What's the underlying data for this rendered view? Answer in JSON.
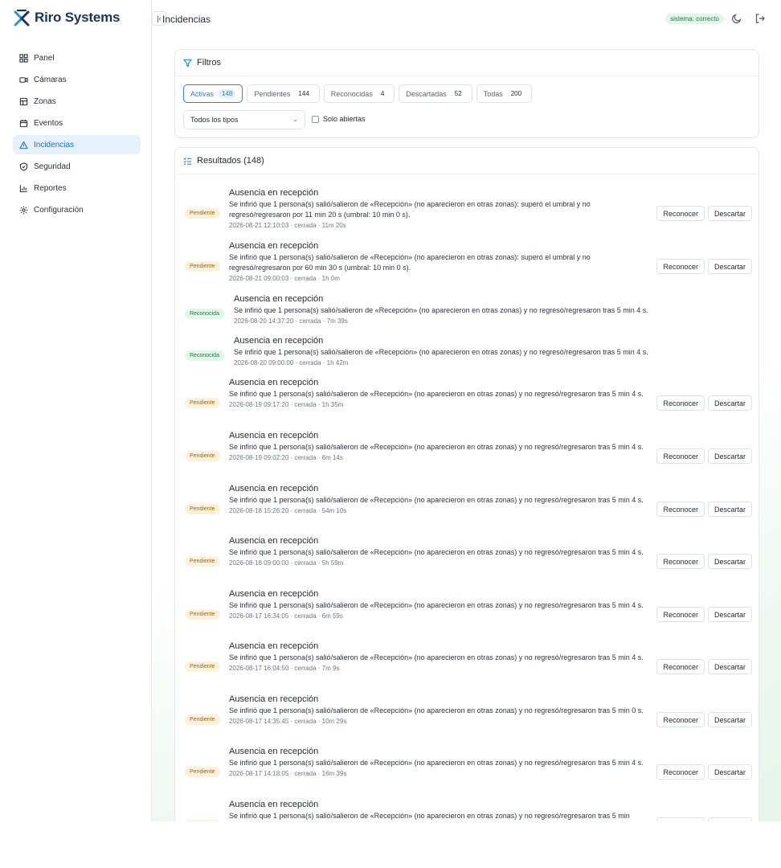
{
  "brand": {
    "name": "Riro Systems"
  },
  "nav": [
    {
      "label": "Panel",
      "icon": "grid-icon",
      "active": false
    },
    {
      "label": "Cámaras",
      "icon": "camera-icon",
      "active": false
    },
    {
      "label": "Zonas",
      "icon": "zone-icon",
      "active": false
    },
    {
      "label": "Eventos",
      "icon": "calendar-icon",
      "active": false
    },
    {
      "label": "Incidencias",
      "icon": "warning-icon",
      "active": true
    },
    {
      "label": "Seguridad",
      "icon": "shield-icon",
      "active": false
    },
    {
      "label": "Reportes",
      "icon": "chart-icon",
      "active": false
    },
    {
      "label": "Configuración",
      "icon": "gear-icon",
      "active": false
    }
  ],
  "header": {
    "collapse_glyph": "|‹",
    "title": "Incidencias",
    "status": "sistema: correcto"
  },
  "filters": {
    "title": "Filtros",
    "tabs": [
      {
        "label": "Activas",
        "count": "148",
        "active": true
      },
      {
        "label": "Pendientes",
        "count": "144",
        "active": false
      },
      {
        "label": "Reconocidas",
        "count": "4",
        "active": false
      },
      {
        "label": "Descartadas",
        "count": "52",
        "active": false
      },
      {
        "label": "Todas",
        "count": "200",
        "active": false
      }
    ],
    "type_select": "Todos los tipos",
    "only_open_label": "Solo abiertas"
  },
  "results": {
    "title": "Resultados (148)",
    "actions": {
      "acknowledge": "Reconocer",
      "discard": "Descartar"
    },
    "items": [
      {
        "status": "Pendiente",
        "title": "Ausencia en recepción",
        "desc": "Se infirió que 1 persona(s) salió/salieron de «Recepción» (no aparecieron en otras zonas): superó el umbral y no regresó/regresaron por 11 min 20 s (umbral: 10 min 0 s).",
        "meta": "2026-08-21 12:10:03 · cerrada · 11m 20s"
      },
      {
        "status": "Pendiente",
        "title": "Ausencia en recepción",
        "desc": "Se infirió que 1 persona(s) salió/salieron de «Recepción» (no aparecieron en otras zonas): superó el umbral y no regresó/regresaron por 60 min 30 s (umbral: 10 min 0 s).",
        "meta": "2026-08-21 09:00:03 · cerrada · 1h 0m"
      },
      {
        "status": "Reconocida",
        "title": "Ausencia en recepción",
        "desc": "Se infirió que 1 persona(s) salió/salieron de «Recepción» (no aparecieron en otras zonas) y no regresó/regresaron tras 5 min 4 s.",
        "meta": "2026-08-20 14:37:20 · cerrada · 7m 39s"
      },
      {
        "status": "Reconocida",
        "title": "Ausencia en recepción",
        "desc": "Se infirió que 1 persona(s) salió/salieron de «Recepción» (no aparecieron en otras zonas) y no regresó/regresaron tras 5 min 4 s.",
        "meta": "2026-08-20 09:00:00 · cerrada · 1h 42m"
      },
      {
        "status": "Pendiente",
        "title": "Ausencia en recepción",
        "desc": "Se infirió que 1 persona(s) salió/salieron de «Recepción» (no aparecieron en otras zonas) y no regresó/regresaron tras 5 min 4 s.",
        "meta": "2026-08-19 09:17:20 · cerrada · 1h 35m"
      },
      {
        "status": "Pendiente",
        "title": "Ausencia en recepción",
        "desc": "Se infirió que 1 persona(s) salió/salieron de «Recepción» (no aparecieron en otras zonas) y no regresó/regresaron tras 5 min 4 s.",
        "meta": "2026-08-19 09:02:20 · cerrada · 6m 14s"
      },
      {
        "status": "Pendiente",
        "title": "Ausencia en recepción",
        "desc": "Se infirió que 1 persona(s) salió/salieron de «Recepción» (no aparecieron en otras zonas) y no regresó/regresaron tras 5 min 4 s.",
        "meta": "2026-08-18 15:26:20 · cerrada · 54m 10s"
      },
      {
        "status": "Pendiente",
        "title": "Ausencia en recepción",
        "desc": "Se infirió que 1 persona(s) salió/salieron de «Recepción» (no aparecieron en otras zonas) y no regresó/regresaron tras 5 min 4 s.",
        "meta": "2026-08-18 09:00:00 · cerrada · 5h 59m"
      },
      {
        "status": "Pendiente",
        "title": "Ausencia en recepción",
        "desc": "Se infirió que 1 persona(s) salió/salieron de «Recepción» (no aparecieron en otras zonas) y no regresó/regresaron tras 5 min 4 s.",
        "meta": "2026-08-17 16:34:05 · cerrada · 6m 59s"
      },
      {
        "status": "Pendiente",
        "title": "Ausencia en recepción",
        "desc": "Se infirió que 1 persona(s) salió/salieron de «Recepción» (no aparecieron en otras zonas) y no regresó/regresaron tras 5 min 4 s.",
        "meta": "2026-08-17 16:04:50 · cerrada · 7m 9s"
      },
      {
        "status": "Pendiente",
        "title": "Ausencia en recepción",
        "desc": "Se infirió que 1 persona(s) salió/salieron de «Recepción» (no aparecieron en otras zonas) y no regresó/regresaron tras 5 min 0 s.",
        "meta": "2026-08-17 14:35:45 · cerrada · 10m 29s"
      },
      {
        "status": "Pendiente",
        "title": "Ausencia en recepción",
        "desc": "Se infirió que 1 persona(s) salió/salieron de «Recepción» (no aparecieron en otras zonas) y no regresó/regresaron tras 5 min 4 s.",
        "meta": "2026-08-17 14:18:05 · cerrada · 16m 39s"
      },
      {
        "status": "Pendiente",
        "title": "Ausencia en recepción",
        "desc": "Se infirió que 1 persona(s) salió/salieron de «Recepción» (no aparecieron en otras zonas) y no regresó/regresaron tras 5 min",
        "meta": ""
      }
    ]
  }
}
